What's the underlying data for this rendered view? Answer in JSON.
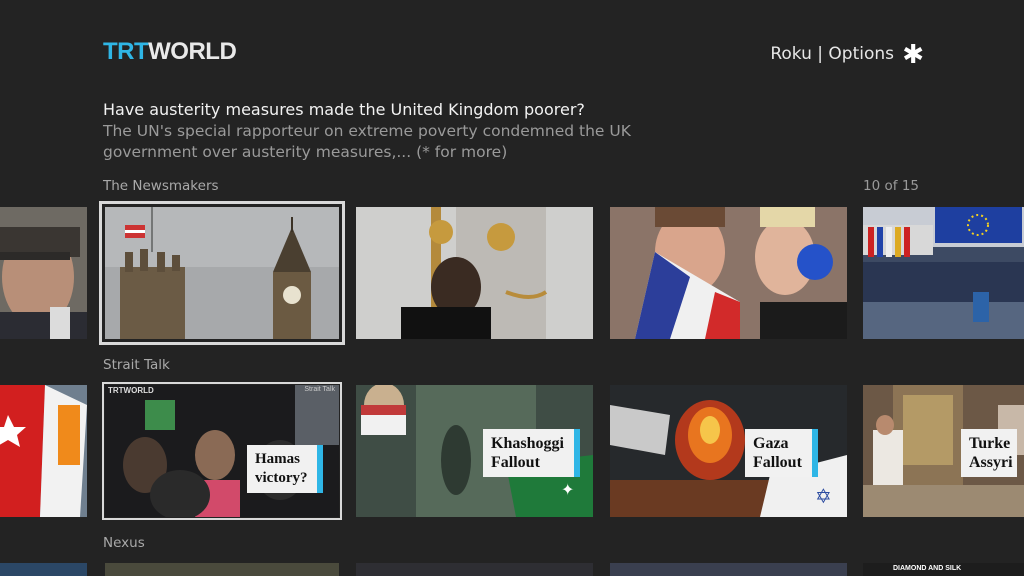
{
  "header": {
    "logo_left": "TRT",
    "logo_right": "WORLD",
    "options_text": "Roku | Options",
    "options_icon": "asterisk-icon"
  },
  "feature": {
    "headline": "Have austerity measures made the United Kingdom poorer?",
    "summary": "The UN's special rapporteur on extreme poverty condemned the UK government over austerity measures,... (* for more)"
  },
  "rows": [
    {
      "title": "The Newsmakers",
      "counter": "10 of 15",
      "tiles": [
        "man-portrait",
        "big-ben-parliament",
        "consulate-door",
        "protest-flag-megaphone",
        "european-parliament"
      ]
    },
    {
      "title": "Strait Talk",
      "tiles": [
        {
          "image": "turkish-flags"
        },
        {
          "image": "protest-crowd",
          "logo": "TRTWORLD",
          "tag": "Strait Talk",
          "caption": [
            "Hamas",
            "victory?"
          ]
        },
        {
          "image": "saudi-silhouette",
          "caption": [
            "Khashoggi",
            "Fallout"
          ]
        },
        {
          "image": "gaza-explosion",
          "caption": [
            "Gaza",
            "Fallout"
          ]
        },
        {
          "image": "church-interior",
          "caption": [
            "Turke",
            "Assyri"
          ]
        }
      ]
    },
    {
      "title": "Nexus",
      "tiles": [
        "nexus-1",
        "nexus-2",
        "nexus-3",
        "nexus-4",
        "nexus-5",
        {
          "tag": "DIAMOND AND SILK"
        }
      ]
    }
  ]
}
